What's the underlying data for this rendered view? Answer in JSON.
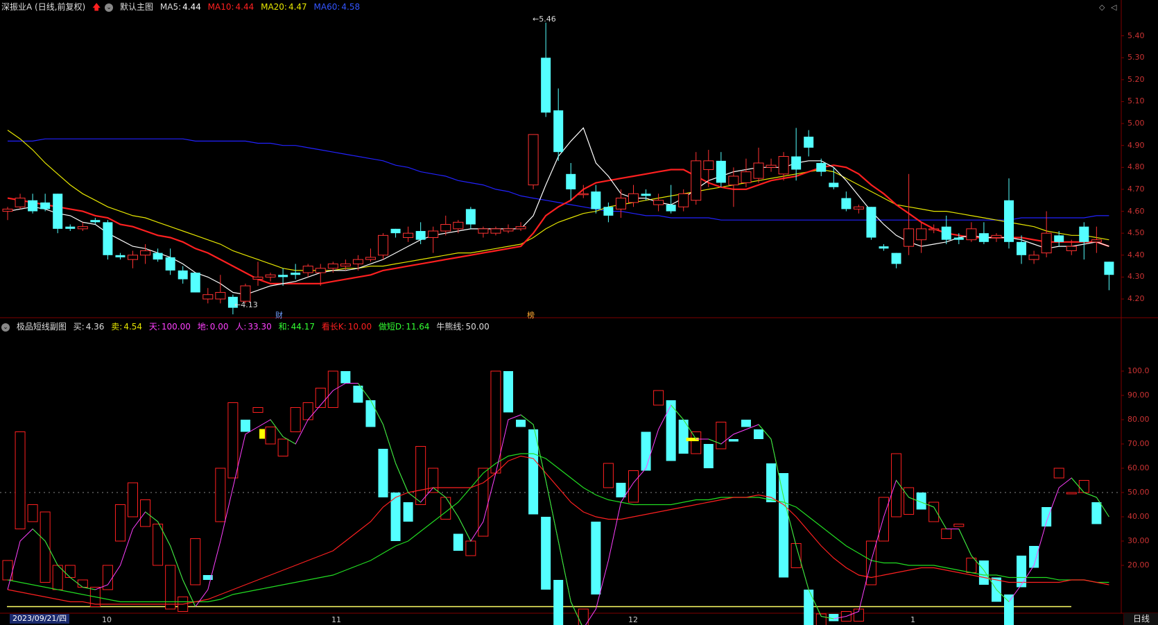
{
  "main_header": {
    "stock": "深振业A (日线,前复权)",
    "theme": "默认主图",
    "ma5_label": "MA5:",
    "ma5": "4.44",
    "ma10_label": "MA10:",
    "ma10": "4.44",
    "ma20_label": "MA20:",
    "ma20": "4.47",
    "ma60_label": "MA60:",
    "ma60": "4.58"
  },
  "sub_header": {
    "name": "极品短线副图",
    "buy_label": "买:",
    "buy": "4.36",
    "sell_label": "卖:",
    "sell": "4.54",
    "tian_label": "天:",
    "tian": "100.00",
    "di_label": "地:",
    "di": "0.00",
    "ren_label": "人:",
    "ren": "33.30",
    "he_label": "和:",
    "he": "44.17",
    "klong_label": "看长K:",
    "klong": "10.00",
    "dshort_label": "做短D:",
    "dshort": "11.64",
    "bull_label": "牛熊线:",
    "bull": "50.00"
  },
  "annotations": {
    "high": "5.46",
    "low": "4.13",
    "cai": "财",
    "bang": "榜"
  },
  "price_axis": [
    "5.40",
    "5.30",
    "5.20",
    "5.10",
    "5.00",
    "4.90",
    "4.80",
    "4.70",
    "4.60",
    "4.50",
    "4.40",
    "4.30",
    "4.20"
  ],
  "osc_axis": [
    "100.0",
    "90.00",
    "80.00",
    "70.00",
    "60.00",
    "50.00",
    "40.00",
    "30.00",
    "20.00"
  ],
  "date_axis": {
    "current": "2023/09/21/四",
    "months": [
      "10",
      "11",
      "12",
      "1"
    ]
  },
  "timeframe": "日线",
  "colors": {
    "up": "#ff3232",
    "down": "#54ffff",
    "ma5": "#ffffff",
    "ma10": "#ff2020",
    "ma20": "#e6e600",
    "ma60": "#2222ff",
    "axis": "#800000"
  },
  "chart_data": {
    "type": "candlestick",
    "price_range": [
      4.14,
      5.5
    ],
    "candles": [
      [
        4.6,
        4.61,
        4.56,
        4.62
      ],
      [
        4.62,
        4.66,
        4.61,
        4.68
      ],
      [
        4.65,
        4.6,
        4.59,
        4.68
      ],
      [
        4.64,
        4.61,
        4.6,
        4.68
      ],
      [
        4.68,
        4.52,
        4.5,
        4.68
      ],
      [
        4.53,
        4.52,
        4.51,
        4.54
      ],
      [
        4.52,
        4.53,
        4.51,
        4.55
      ],
      [
        4.56,
        4.55,
        4.54,
        4.57
      ],
      [
        4.55,
        4.4,
        4.38,
        4.56
      ],
      [
        4.4,
        4.39,
        4.38,
        4.41
      ],
      [
        4.38,
        4.4,
        4.34,
        4.42
      ],
      [
        4.4,
        4.42,
        4.36,
        4.45
      ],
      [
        4.41,
        4.38,
        4.37,
        4.43
      ],
      [
        4.39,
        4.33,
        4.31,
        4.43
      ],
      [
        4.33,
        4.29,
        4.27,
        4.35
      ],
      [
        4.32,
        4.23,
        4.23,
        4.32
      ],
      [
        4.2,
        4.22,
        4.18,
        4.25
      ],
      [
        4.2,
        4.23,
        4.18,
        4.31
      ],
      [
        4.21,
        4.16,
        4.13,
        4.22
      ],
      [
        4.19,
        4.26,
        4.18,
        4.27
      ],
      [
        4.29,
        4.3,
        4.26,
        4.37
      ],
      [
        4.3,
        4.31,
        4.28,
        4.32
      ],
      [
        4.31,
        4.3,
        4.26,
        4.34
      ],
      [
        4.32,
        4.31,
        4.29,
        4.36
      ],
      [
        4.32,
        4.35,
        4.3,
        4.36
      ],
      [
        4.32,
        4.34,
        4.26,
        4.36
      ],
      [
        4.34,
        4.36,
        4.32,
        4.37
      ],
      [
        4.35,
        4.36,
        4.33,
        4.38
      ],
      [
        4.36,
        4.38,
        4.33,
        4.4
      ],
      [
        4.38,
        4.39,
        4.37,
        4.43
      ],
      [
        4.4,
        4.49,
        4.38,
        4.5
      ],
      [
        4.52,
        4.5,
        4.48,
        4.52
      ],
      [
        4.48,
        4.5,
        4.46,
        4.53
      ],
      [
        4.51,
        4.47,
        4.45,
        4.55
      ],
      [
        4.48,
        4.51,
        4.41,
        4.53
      ],
      [
        4.51,
        4.54,
        4.49,
        4.58
      ],
      [
        4.52,
        4.55,
        4.5,
        4.56
      ],
      [
        4.61,
        4.54,
        4.52,
        4.62
      ],
      [
        4.5,
        4.52,
        4.48,
        4.53
      ],
      [
        4.5,
        4.52,
        4.49,
        4.53
      ],
      [
        4.51,
        4.52,
        4.5,
        4.54
      ],
      [
        4.52,
        4.53,
        4.51,
        4.55
      ],
      [
        4.72,
        4.95,
        4.7,
        4.95
      ],
      [
        5.3,
        5.05,
        5.03,
        5.46
      ],
      [
        5.06,
        4.87,
        4.83,
        5.16
      ],
      [
        4.77,
        4.7,
        4.65,
        4.82
      ],
      [
        4.68,
        4.68,
        4.66,
        4.72
      ],
      [
        4.69,
        4.61,
        4.59,
        4.72
      ],
      [
        4.62,
        4.58,
        4.55,
        4.64
      ],
      [
        4.61,
        4.66,
        4.57,
        4.7
      ],
      [
        4.64,
        4.68,
        4.62,
        4.72
      ],
      [
        4.68,
        4.67,
        4.65,
        4.7
      ],
      [
        4.63,
        4.65,
        4.6,
        4.68
      ],
      [
        4.63,
        4.6,
        4.59,
        4.72
      ],
      [
        4.62,
        4.68,
        4.6,
        4.7
      ],
      [
        4.65,
        4.83,
        4.63,
        4.87
      ],
      [
        4.79,
        4.83,
        4.71,
        4.88
      ],
      [
        4.83,
        4.73,
        4.71,
        4.87
      ],
      [
        4.72,
        4.76,
        4.62,
        4.8
      ],
      [
        4.73,
        4.78,
        4.71,
        4.84
      ],
      [
        4.75,
        4.82,
        4.73,
        4.89
      ],
      [
        4.8,
        4.81,
        4.78,
        4.84
      ],
      [
        4.77,
        4.85,
        4.74,
        4.87
      ],
      [
        4.85,
        4.79,
        4.74,
        4.98
      ],
      [
        4.94,
        4.89,
        4.85,
        4.97
      ],
      [
        4.82,
        4.78,
        4.76,
        4.84
      ],
      [
        4.73,
        4.71,
        4.7,
        4.8
      ],
      [
        4.66,
        4.61,
        4.6,
        4.69
      ],
      [
        4.61,
        4.62,
        4.59,
        4.63
      ],
      [
        4.62,
        4.48,
        4.47,
        4.62
      ],
      [
        4.44,
        4.43,
        4.42,
        4.45
      ],
      [
        4.41,
        4.36,
        4.34,
        4.41
      ],
      [
        4.44,
        4.52,
        4.4,
        4.77
      ],
      [
        4.47,
        4.52,
        4.41,
        4.55
      ],
      [
        4.52,
        4.52,
        4.5,
        4.54
      ],
      [
        4.53,
        4.47,
        4.45,
        4.58
      ],
      [
        4.48,
        4.47,
        4.45,
        4.5
      ],
      [
        4.47,
        4.52,
        4.46,
        4.55
      ],
      [
        4.5,
        4.46,
        4.45,
        4.55
      ],
      [
        4.48,
        4.49,
        4.46,
        4.5
      ],
      [
        4.65,
        4.46,
        4.43,
        4.75
      ],
      [
        4.46,
        4.4,
        4.36,
        4.49
      ],
      [
        4.38,
        4.4,
        4.36,
        4.42
      ],
      [
        4.41,
        4.5,
        4.39,
        4.6
      ],
      [
        4.49,
        4.46,
        4.44,
        4.51
      ],
      [
        4.42,
        4.44,
        4.4,
        4.47
      ],
      [
        4.53,
        4.46,
        4.38,
        4.55
      ],
      [
        4.46,
        4.47,
        4.41,
        4.53
      ],
      [
        4.37,
        4.31,
        4.24,
        4.37
      ]
    ],
    "ma5": [
      4.6,
      4.61,
      4.62,
      4.61,
      4.59,
      4.58,
      4.55,
      4.54,
      4.5,
      4.47,
      4.44,
      4.43,
      4.41,
      4.39,
      4.36,
      4.32,
      4.3,
      4.27,
      4.23,
      4.22,
      4.24,
      4.26,
      4.27,
      4.28,
      4.3,
      4.32,
      4.33,
      4.33,
      4.34,
      4.36,
      4.38,
      4.41,
      4.44,
      4.47,
      4.49,
      4.5,
      4.51,
      4.52,
      4.52,
      4.52,
      4.52,
      4.52,
      4.58,
      4.72,
      4.85,
      4.92,
      4.98,
      4.82,
      4.76,
      4.68,
      4.66,
      4.66,
      4.64,
      4.63,
      4.66,
      4.7,
      4.74,
      4.76,
      4.78,
      4.79,
      4.8,
      4.8,
      4.8,
      4.82,
      4.83,
      4.83,
      4.8,
      4.74,
      4.67,
      4.6,
      4.54,
      4.49,
      4.46,
      4.44,
      4.45,
      4.46,
      4.48,
      4.49,
      4.48,
      4.48,
      4.48,
      4.47,
      4.45,
      4.43,
      4.44,
      4.44,
      4.45,
      4.46,
      4.44
    ],
    "ma10": [
      4.66,
      4.65,
      4.64,
      4.63,
      4.62,
      4.61,
      4.6,
      4.58,
      4.57,
      4.54,
      4.53,
      4.51,
      4.49,
      4.48,
      4.46,
      4.43,
      4.41,
      4.38,
      4.35,
      4.32,
      4.29,
      4.27,
      4.27,
      4.27,
      4.27,
      4.27,
      4.28,
      4.29,
      4.3,
      4.31,
      4.33,
      4.34,
      4.35,
      4.36,
      4.37,
      4.38,
      4.39,
      4.4,
      4.41,
      4.42,
      4.43,
      4.44,
      4.5,
      4.58,
      4.62,
      4.65,
      4.7,
      4.73,
      4.74,
      4.75,
      4.76,
      4.77,
      4.78,
      4.79,
      4.79,
      4.76,
      4.73,
      4.71,
      4.7,
      4.7,
      4.72,
      4.74,
      4.75,
      4.76,
      4.78,
      4.8,
      4.81,
      4.8,
      4.77,
      4.72,
      4.68,
      4.63,
      4.59,
      4.55,
      4.52,
      4.5,
      4.49,
      4.48,
      4.48,
      4.48,
      4.48,
      4.48,
      4.47,
      4.46,
      4.46,
      4.46,
      4.46,
      4.46,
      4.44
    ],
    "ma20": [
      4.97,
      4.93,
      4.88,
      4.82,
      4.77,
      4.72,
      4.68,
      4.65,
      4.62,
      4.6,
      4.58,
      4.57,
      4.55,
      4.53,
      4.51,
      4.49,
      4.47,
      4.45,
      4.42,
      4.4,
      4.38,
      4.36,
      4.34,
      4.33,
      4.33,
      4.33,
      4.33,
      4.34,
      4.34,
      4.35,
      4.35,
      4.36,
      4.37,
      4.38,
      4.39,
      4.4,
      4.41,
      4.41,
      4.42,
      4.43,
      4.44,
      4.45,
      4.48,
      4.52,
      4.55,
      4.57,
      4.59,
      4.6,
      4.62,
      4.63,
      4.64,
      4.65,
      4.66,
      4.67,
      4.68,
      4.69,
      4.7,
      4.71,
      4.72,
      4.73,
      4.74,
      4.75,
      4.76,
      4.77,
      4.78,
      4.79,
      4.78,
      4.75,
      4.72,
      4.69,
      4.66,
      4.63,
      4.62,
      4.61,
      4.6,
      4.6,
      4.59,
      4.58,
      4.57,
      4.56,
      4.55,
      4.54,
      4.53,
      4.51,
      4.5,
      4.49,
      4.49,
      4.48,
      4.47
    ],
    "ma60": [
      4.92,
      4.92,
      4.92,
      4.93,
      4.93,
      4.93,
      4.93,
      4.93,
      4.93,
      4.93,
      4.93,
      4.93,
      4.93,
      4.93,
      4.93,
      4.92,
      4.92,
      4.92,
      4.92,
      4.92,
      4.91,
      4.91,
      4.9,
      4.9,
      4.89,
      4.88,
      4.87,
      4.86,
      4.85,
      4.84,
      4.83,
      4.81,
      4.8,
      4.78,
      4.77,
      4.76,
      4.74,
      4.73,
      4.72,
      4.7,
      4.69,
      4.67,
      4.66,
      4.65,
      4.64,
      4.63,
      4.62,
      4.61,
      4.6,
      4.6,
      4.59,
      4.58,
      4.58,
      4.57,
      4.57,
      4.57,
      4.57,
      4.56,
      4.56,
      4.56,
      4.56,
      4.56,
      4.56,
      4.56,
      4.56,
      4.56,
      4.56,
      4.56,
      4.56,
      4.56,
      4.56,
      4.56,
      4.56,
      4.56,
      4.56,
      4.56,
      4.56,
      4.56,
      4.56,
      4.56,
      4.56,
      4.57,
      4.57,
      4.57,
      4.57,
      4.57,
      4.57,
      4.58,
      4.58
    ],
    "osc_bars": [
      [
        14,
        22
      ],
      [
        35,
        75
      ],
      [
        38,
        45
      ],
      [
        13,
        42
      ],
      [
        10,
        20
      ],
      [
        15,
        20
      ],
      [
        11,
        14
      ],
      [
        3,
        11
      ],
      [
        10,
        20
      ],
      [
        30,
        45
      ],
      [
        40,
        54
      ],
      [
        36,
        47
      ],
      [
        20,
        37
      ],
      [
        2,
        20
      ],
      [
        1,
        7
      ],
      [
        12,
        31
      ],
      [
        16,
        14
      ],
      [
        38,
        60
      ],
      [
        56,
        87
      ],
      [
        80,
        75
      ],
      [
        83,
        85
      ],
      [
        70,
        77
      ],
      [
        65,
        72
      ],
      [
        75,
        85
      ],
      [
        80,
        87
      ],
      [
        85,
        93
      ],
      [
        85,
        100
      ],
      [
        100,
        95
      ],
      [
        94,
        87
      ],
      [
        88,
        77
      ],
      [
        68,
        48
      ],
      [
        50,
        30
      ],
      [
        46,
        38
      ],
      [
        45,
        69
      ],
      [
        50,
        60
      ],
      [
        39,
        48
      ],
      [
        33,
        26
      ],
      [
        24,
        30
      ],
      [
        32,
        60
      ],
      [
        58,
        100
      ],
      [
        100,
        83
      ],
      [
        80,
        77
      ],
      [
        76,
        41
      ],
      [
        40,
        10
      ],
      [
        14,
        -5
      ],
      [
        -5,
        -13
      ],
      [
        -6,
        2
      ],
      [
        38,
        8
      ],
      [
        52,
        62
      ],
      [
        54,
        48
      ],
      [
        46,
        59
      ],
      [
        75,
        59
      ],
      [
        86,
        92
      ],
      [
        88,
        63
      ],
      [
        80,
        66
      ],
      [
        66,
        75
      ],
      [
        70,
        60
      ],
      [
        68,
        79
      ],
      [
        72,
        71
      ],
      [
        80,
        77
      ],
      [
        76,
        72
      ],
      [
        62,
        46
      ],
      [
        58,
        15
      ],
      [
        19,
        29
      ],
      [
        10,
        -5
      ],
      [
        -6,
        0
      ],
      [
        0,
        -3
      ],
      [
        -3,
        1
      ],
      [
        -3,
        2
      ],
      [
        12,
        30
      ],
      [
        30,
        48
      ],
      [
        40,
        66
      ],
      [
        41,
        52
      ],
      [
        50,
        43
      ],
      [
        38,
        46
      ],
      [
        31,
        35
      ],
      [
        36,
        37
      ],
      [
        17,
        23
      ],
      [
        22,
        12
      ],
      [
        15,
        5
      ],
      [
        8,
        -5
      ],
      [
        24,
        11
      ],
      [
        28,
        19
      ],
      [
        44,
        36
      ],
      [
        56,
        60
      ],
      [
        50,
        50
      ],
      [
        50,
        55
      ],
      [
        46,
        37
      ]
    ],
    "osc_k": [
      10,
      30,
      35,
      30,
      20,
      15,
      11,
      10,
      12,
      20,
      35,
      42,
      38,
      28,
      14,
      3,
      10,
      30,
      52,
      74,
      77,
      80,
      73,
      70,
      80,
      86,
      92,
      95,
      95,
      88,
      78,
      62,
      50,
      46,
      52,
      48,
      40,
      30,
      38,
      58,
      80,
      82,
      78,
      55,
      30,
      5,
      -6,
      2,
      22,
      46,
      54,
      60,
      76,
      86,
      80,
      72,
      72,
      70,
      74,
      76,
      78,
      72,
      48,
      28,
      10,
      -1,
      -2,
      -1,
      1,
      22,
      40,
      55,
      48,
      46,
      44,
      35,
      35,
      24,
      18,
      10,
      5,
      12,
      20,
      38,
      52,
      56,
      50,
      48,
      40
    ],
    "osc_k_red": [
      10,
      9,
      8,
      7,
      6,
      5,
      5,
      4,
      4,
      4,
      4,
      4,
      4,
      4,
      4,
      5,
      6,
      8,
      10,
      12,
      14,
      16,
      18,
      20,
      22,
      24,
      26,
      30,
      34,
      38,
      44,
      48,
      50,
      51,
      52,
      52,
      52,
      52,
      54,
      58,
      63,
      65,
      64,
      58,
      52,
      46,
      42,
      40,
      39,
      39,
      40,
      41,
      42,
      43,
      44,
      45,
      46,
      47,
      48,
      48,
      49,
      48,
      45,
      40,
      34,
      28,
      23,
      19,
      16,
      15,
      16,
      17,
      18,
      19,
      19,
      18,
      17,
      16,
      15,
      14,
      13,
      13,
      13,
      13,
      13,
      14,
      14,
      13,
      12
    ],
    "osc_d_green": [
      14,
      13,
      12,
      11,
      10,
      9,
      8,
      7,
      6,
      5,
      5,
      5,
      5,
      5,
      5,
      5,
      5,
      6,
      8,
      9,
      10,
      11,
      12,
      13,
      14,
      15,
      16,
      18,
      20,
      22,
      25,
      28,
      30,
      34,
      38,
      42,
      46,
      52,
      58,
      62,
      65,
      66,
      66,
      64,
      60,
      56,
      52,
      49,
      47,
      46,
      45,
      45,
      45,
      45,
      46,
      47,
      47,
      48,
      48,
      48,
      48,
      47,
      46,
      44,
      40,
      36,
      32,
      28,
      25,
      22,
      21,
      21,
      20,
      20,
      20,
      19,
      18,
      17,
      16,
      16,
      15,
      15,
      15,
      15,
      14,
      14,
      14,
      13,
      13
    ],
    "osc_bull": 50,
    "osc_floor": 3
  }
}
